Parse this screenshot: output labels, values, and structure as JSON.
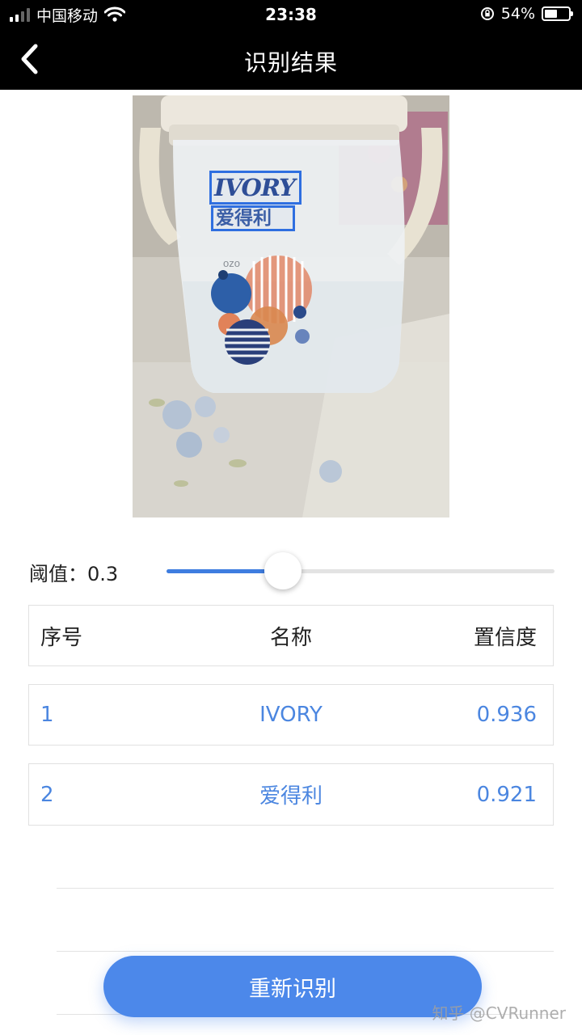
{
  "status_bar": {
    "carrier": "中国移动",
    "time": "23:38",
    "battery_percent": "54%",
    "battery_level": 0.54,
    "icons": [
      "signal-icon",
      "wifi-icon",
      "orientation-lock-icon",
      "battery-icon"
    ]
  },
  "nav": {
    "title": "识别结果",
    "back_icon": "chevron-left-icon"
  },
  "image": {
    "detections": [
      {
        "text": "IVORY"
      },
      {
        "text": "爱得利"
      }
    ],
    "box_color": "#2f6fe0"
  },
  "threshold": {
    "label": "阈值：0.3",
    "value": 0.3
  },
  "table": {
    "columns": [
      "序号",
      "名称",
      "置信度"
    ],
    "rows": [
      {
        "index": "1",
        "name": "IVORY",
        "confidence": "0.936"
      },
      {
        "index": "2",
        "name": "爱得利",
        "confidence": "0.921"
      }
    ]
  },
  "button": {
    "label": "重新识别"
  },
  "watermark": "知乎 @CVRunner",
  "colors": {
    "accent": "#4c88ea",
    "slider": "#3e7de0",
    "row_text": "#4b86e0",
    "nav_bg": "#000000"
  }
}
